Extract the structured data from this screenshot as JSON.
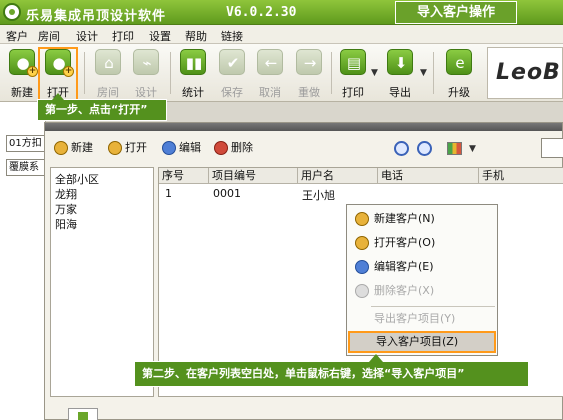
{
  "app": {
    "title": "乐易集成吊顶设计软件",
    "version": "V6.0.2.30",
    "banner": "导入客户操作",
    "logo_icon": "green-circle-logo-icon"
  },
  "menu": [
    "客户",
    "房间",
    "设计",
    "打印",
    "设置",
    "帮助",
    "链接"
  ],
  "toolbar": {
    "new": "新建",
    "open": "打开",
    "room": "房间",
    "design": "设计",
    "stats": "统计",
    "save": "保存",
    "cancel": "取消",
    "redo": "重做",
    "print": "打印",
    "export": "导出",
    "upgrade": "升级",
    "brand": "LeoB"
  },
  "callout_step1": "第一步、点击“打开”",
  "left": {
    "combo1": "01方扣",
    "combo2": "覆膜系"
  },
  "dialog": {
    "toolbar": {
      "new": "新建",
      "open": "打开",
      "edit": "编辑",
      "delete": "删除"
    },
    "tree": [
      "全部小区",
      "龙翔",
      "万家",
      "阳海"
    ],
    "columns": [
      "序号",
      "项目编号",
      "用户名",
      "电话",
      "手机"
    ],
    "rows": [
      {
        "no": "1",
        "code": "0001",
        "user": "王小旭",
        "phone": "",
        "mobile": ""
      }
    ]
  },
  "context_menu": [
    {
      "label": "新建客户(N)",
      "icon": "new-customer-icon",
      "enabled": true
    },
    {
      "label": "打开客户(O)",
      "icon": "open-customer-icon",
      "enabled": true
    },
    {
      "label": "编辑客户(E)",
      "icon": "edit-customer-icon",
      "enabled": true
    },
    {
      "label": "删除客户(X)",
      "icon": "delete-customer-icon",
      "enabled": false
    },
    {
      "label": "导出客户项目(Y)",
      "icon": "",
      "enabled": false
    },
    {
      "label": "导入客户项目(Z)",
      "icon": "",
      "enabled": true
    }
  ],
  "callout_step2": "第二步、在客户列表空白处，单击鼠标右键，选择“导入客户项目”",
  "colors": {
    "title_green": "#6aa12a",
    "callout_green": "#54911e",
    "highlight_orange": "#ff9a1a"
  }
}
